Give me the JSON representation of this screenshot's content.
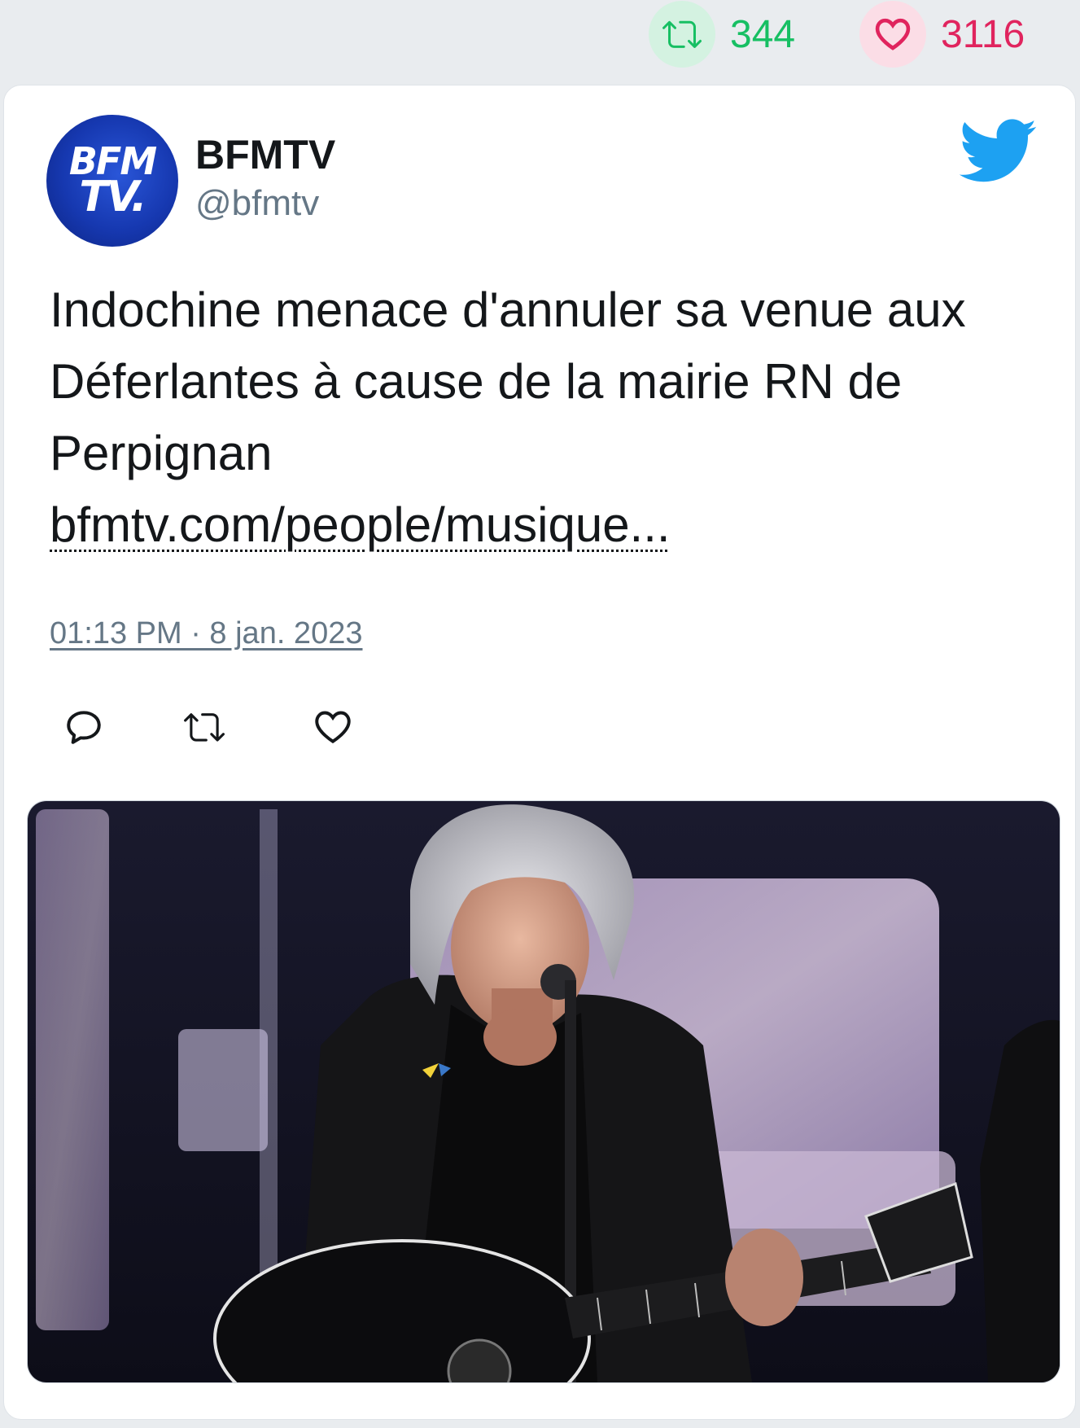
{
  "stats": {
    "retweets": "344",
    "likes": "3116",
    "retweet_color": "#17bf63",
    "like_color": "#e0245e"
  },
  "tweet": {
    "avatar": {
      "line1": "BFM",
      "line2": "TV."
    },
    "display_name": "BFMTV",
    "handle": "@bfmtv",
    "text": "Indochine menace d'annuler sa venue aux Déferlantes à cause de la mairie RN de Perpignan",
    "link": "bfmtv.com/people/musique...",
    "timestamp": "01:13 PM · 8 jan. 2023",
    "actions": [
      "reply-icon",
      "retweet-icon",
      "like-icon"
    ],
    "brand_icon": "twitter-bird-icon",
    "brand_color": "#1da1f2"
  }
}
